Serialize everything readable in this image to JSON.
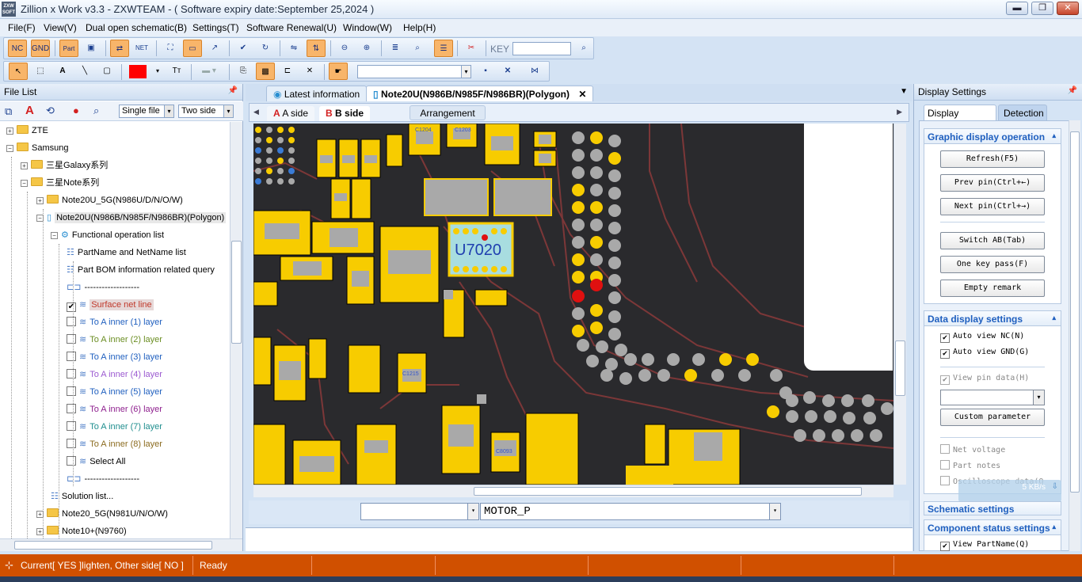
{
  "window": {
    "title": "Zillion x Work v3.3 - ZXWTEAM - ( Software expiry date:September 25,2024 )",
    "logo": "ZXW SOFT",
    "minimize_label": "▬",
    "restore_label": "❐",
    "close_label": "✕"
  },
  "menu": [
    "File(F)",
    "View(V)",
    "Dual open schematic(B)",
    "Settings(T)",
    "Software Renewal(U)",
    "Window(W)",
    "Help(H)"
  ],
  "toolbar": {
    "nc_label": "NC",
    "gnd_label": "GND",
    "part_label": "Part",
    "net_label": "NET",
    "key_label": "KEY",
    "key_value": ""
  },
  "file_list": {
    "title": "File List",
    "pin_icon": "pin-icon",
    "file_mode": "Single file",
    "side_mode": "Two side",
    "tree": [
      {
        "label": "ZTE",
        "type": "folder",
        "level": 1,
        "expanded": false
      },
      {
        "label": "Samsung",
        "type": "folder",
        "level": 1,
        "expanded": true
      },
      {
        "label": "三星Galaxy系列",
        "type": "folder",
        "level": 2,
        "expanded": false
      },
      {
        "label": "三星Note系列",
        "type": "folder",
        "level": 2,
        "expanded": true
      },
      {
        "label": "Note20U_5G(N986U/D/N/O/W)",
        "type": "folder",
        "level": 3,
        "expanded": false
      },
      {
        "label": "Note20U(N986B/N985F/N986BR)(Polygon)",
        "type": "phone",
        "level": 3,
        "expanded": true,
        "selected": true
      },
      {
        "label": "Functional operation list",
        "type": "gear",
        "level": 4
      },
      {
        "label": "PartName and NetName list",
        "type": "list",
        "level": 5
      },
      {
        "label": "Part BOM information related query",
        "type": "list",
        "level": 5
      },
      {
        "label": "-------------------",
        "type": "sep",
        "level": 5
      },
      {
        "label": "Surface net line",
        "type": "check",
        "level": 5,
        "checked": true,
        "color": "#c0392b",
        "highlighted": true
      },
      {
        "label": "To A inner (1) layer",
        "type": "check",
        "level": 5,
        "checked": false,
        "color": "#1f5fbf"
      },
      {
        "label": "To A inner (2) layer",
        "type": "check",
        "level": 5,
        "checked": false,
        "color": "#6b8e23"
      },
      {
        "label": "To A inner (3) layer",
        "type": "check",
        "level": 5,
        "checked": false,
        "color": "#1f5fbf"
      },
      {
        "label": "To A inner (4) layer",
        "type": "check",
        "level": 5,
        "checked": false,
        "color": "#9b59d0"
      },
      {
        "label": "To A inner (5) layer",
        "type": "check",
        "level": 5,
        "checked": false,
        "color": "#1f5fbf"
      },
      {
        "label": "To A inner (6) layer",
        "type": "check",
        "level": 5,
        "checked": false,
        "color": "#8e1f8e"
      },
      {
        "label": "To A inner (7) layer",
        "type": "check",
        "level": 5,
        "checked": false,
        "color": "#1f8e8e"
      },
      {
        "label": "To A inner (8) layer",
        "type": "check",
        "level": 5,
        "checked": false,
        "color": "#8b6b1f"
      },
      {
        "label": "Select All",
        "type": "check",
        "level": 5,
        "checked": false,
        "color": "#000000"
      },
      {
        "label": "-------------------",
        "type": "sep",
        "level": 5
      },
      {
        "label": "Solution list...",
        "type": "list",
        "level": 4
      },
      {
        "label": "Note20_5G(N981U/N/O/W)",
        "type": "folder",
        "level": 3,
        "expanded": false
      },
      {
        "label": "Note10+(N9760)",
        "type": "folder",
        "level": 3,
        "expanded": false
      }
    ]
  },
  "tabs": [
    {
      "label": "Latest information",
      "active": false
    },
    {
      "label": "Note20U(N986B/N985F/N986BR)(Polygon)",
      "active": true,
      "close": "✕"
    }
  ],
  "side_tabs": {
    "a_side": "A side",
    "b_side": "B side",
    "a_letter": "A",
    "b_letter": "B",
    "arrangement": "Arrangement"
  },
  "board": {
    "component_label": "U7020",
    "small_labels": [
      "C1204",
      "C1203",
      "C1215",
      "C8093"
    ]
  },
  "net_bar": {
    "left_value": "",
    "net_value": "MOTOR_P"
  },
  "display_settings": {
    "title": "Display Settings",
    "tabs": [
      "Display Settings",
      "Detection"
    ],
    "graphic_title": "Graphic display operation",
    "buttons": [
      "Refresh(F5)",
      "Prev pin(Ctrl+←)",
      "Next pin(Ctrl+→)",
      "Switch AB(Tab)",
      "One key pass(F)",
      "Empty remark"
    ],
    "data_title": "Data display settings",
    "auto_nc": "Auto view NC(N)",
    "auto_gnd": "Auto view GND(G)",
    "view_pin": "View pin data(H)",
    "custom_param": "Custom parameter",
    "net_voltage": "Net voltage",
    "part_notes": "Part notes",
    "oscilloscope": "Oscilloscope data(Q)",
    "schematic_title": "Schematic settings",
    "component_title": "Component status settings",
    "view_partname": "View PartName(Q)",
    "speed": "5 KB/s"
  },
  "status": {
    "current": "Current[ YES ]lighten, Other side[ NO ]",
    "state": "Ready"
  },
  "colors": {
    "accent": "#1f5fbf",
    "status_bar": "#d05000",
    "pad_yellow": "#f7cc00",
    "pad_gray": "#a9a9a9",
    "board_bg": "#2a2a2d"
  }
}
